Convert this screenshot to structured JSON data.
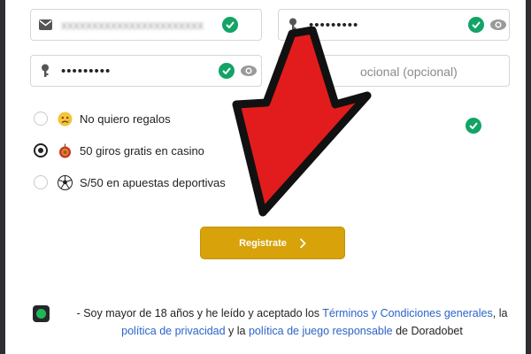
{
  "form": {
    "email_value": "xxxxxxxxxxxxxxxxxxxxxxx",
    "password_value": "•••••••••",
    "confirm_password_value": "•••••••••",
    "promo_placeholder": "ocional (opcional)"
  },
  "bonus_options": [
    {
      "label": "No quiero regalos",
      "icon": "sad-face-icon",
      "selected": false
    },
    {
      "label": "50 giros gratis en casino",
      "icon": "roulette-icon",
      "selected": true
    },
    {
      "label": "S/50 en apuestas deportivas",
      "icon": "soccer-ball-icon",
      "selected": false
    }
  ],
  "register_button": {
    "label": "Registrate"
  },
  "terms": {
    "prefix": "- Soy mayor de 18 años y he leído y aceptado los ",
    "link_terms": "Términos y Condiciones generales",
    "mid1": ", la",
    "link_privacy": "política de privacidad",
    "mid2": " y la ",
    "link_responsible": "política de juego responsable",
    "suffix": " de Doradobet"
  },
  "colors": {
    "accent": "#d7a20a",
    "check_green": "#12a466",
    "link": "#2b63c9",
    "arrow": "#e21c1c"
  }
}
